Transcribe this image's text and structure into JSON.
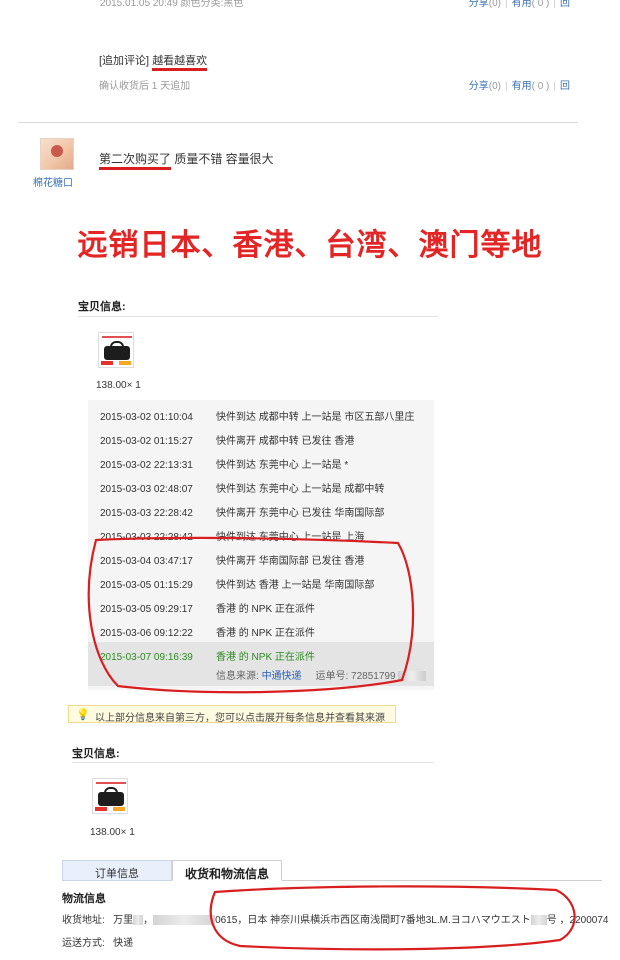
{
  "review": {
    "top_meta": "2015.01.05 20:49   颜色分类:黑色",
    "top_actions": {
      "share": "分享",
      "share_count": "(0)",
      "useful": "有用",
      "useful_count": "( 0 )",
      "reply": "回"
    },
    "followup_label": "[追加评论]",
    "followup_text": "越看越喜欢",
    "followup_meta": "确认收货后 1 天追加",
    "followup_actions": {
      "share": "分享",
      "share_count": "(0)",
      "useful": "有用",
      "useful_count": "( 0 )",
      "reply": "回"
    },
    "second_text_a": "第二次购买了",
    "second_text_b": " 质量不错 容量很大",
    "second_user": "棉花糖口"
  },
  "banner": "远销日本、香港、台湾、澳门等地",
  "item_section_1": {
    "title": "宝贝信息:",
    "price": "138.00× 1"
  },
  "tracking": [
    {
      "time": "2015-03-02 01:10:04",
      "status": "快件到达 成都中转 上一站是 市区五部八里庄"
    },
    {
      "time": "2015-03-02 01:15:27",
      "status": "快件离开 成都中转 已发往 香港"
    },
    {
      "time": "2015-03-02 22:13:31",
      "status": "快件到达 东莞中心 上一站是 *"
    },
    {
      "time": "2015-03-03 02:48:07",
      "status": "快件到达 东莞中心 上一站是 成都中转"
    },
    {
      "time": "2015-03-03 22:28:42",
      "status": "快件离开 东莞中心 已发往 华南国际部"
    },
    {
      "time": "2015-03-03 22:28:42",
      "status": "快件到达 东莞中心 上一站是 上海"
    },
    {
      "time": "2015-03-04 03:47:17",
      "status": "快件离开 华南国际部 已发往 香港"
    },
    {
      "time": "2015-03-05 01:15:29",
      "status": "快件到达 香港 上一站是 华南国际部"
    },
    {
      "time": "2015-03-05 09:29:17",
      "status": "香港 的 NPK 正在派件"
    },
    {
      "time": "2015-03-06 09:12:22",
      "status": "香港 的 NPK 正在派件"
    },
    {
      "time": "2015-03-07 09:16:39",
      "status": "香港 的 NPK 正在派件"
    }
  ],
  "tracking_source": {
    "label": "信息来源:",
    "carrier": "中通快递",
    "waybill_label": "运单号:",
    "waybill": "72851799"
  },
  "notice": "以上部分信息来自第三方，您可以点击展开每条信息并查看其来源",
  "item_section_2": {
    "title": "宝贝信息:",
    "price": "138.00× 1"
  },
  "tabs": {
    "order": "订单信息",
    "shipping": "收货和物流信息"
  },
  "logistics": {
    "title": "物流信息",
    "address_label": "收货地址:",
    "recipient": "万里",
    "phone_end": "0615",
    "address": "日本 神奈川県横浜市西区南浅間町7番地3L.M.ヨコハマウエスト",
    "address_tail": "号 ，",
    "postcode": "2200074",
    "method_label": "运送方式:",
    "method": "快递"
  },
  "colors": {
    "annotation_red": "#d81e1e",
    "link_blue": "#2b62b8",
    "latest_green": "#2e8b22"
  }
}
